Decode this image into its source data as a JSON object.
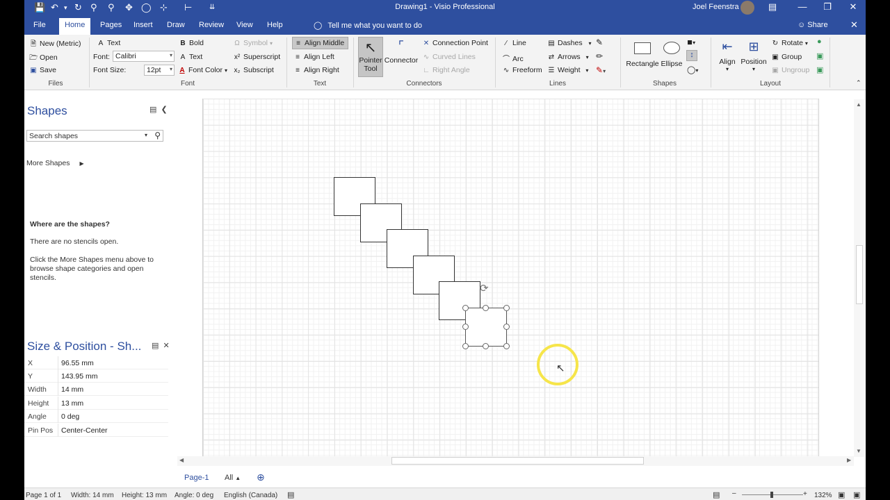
{
  "window": {
    "title": "Drawing1  -  Visio Professional",
    "user": "Joel Feenstra"
  },
  "tabs": [
    "File",
    "Home",
    "Pages",
    "Insert",
    "Draw",
    "Review",
    "View",
    "Help"
  ],
  "active_tab": "Home",
  "tell_me": "Tell me what you want to do",
  "share": "Share",
  "ribbon": {
    "files": {
      "label": "Files",
      "new": "New (Metric)",
      "open": "Open",
      "save": "Save"
    },
    "font": {
      "label": "Font",
      "text_btn": "Text",
      "font_label": "Font:",
      "font_value": "Calibri",
      "size_label": "Font Size:",
      "size_value": "12pt",
      "bold": "Bold",
      "text2": "Text",
      "font_color": "Font Color",
      "symbol": "Symbol",
      "superscript": "Superscript",
      "subscript": "Subscript"
    },
    "text": {
      "label": "Text",
      "align_middle": "Align Middle",
      "align_left": "Align Left",
      "align_right": "Align Right"
    },
    "connectors": {
      "label": "Connectors",
      "pointer_tool": "Pointer Tool",
      "connector": "Connector",
      "connection_point": "Connection Point",
      "curved_lines": "Curved Lines",
      "right_angle": "Right Angle"
    },
    "lines": {
      "label": "Lines",
      "line": "Line",
      "arc": "Arc",
      "freeform": "Freeform",
      "dashes": "Dashes",
      "arrows": "Arrows",
      "weight": "Weight"
    },
    "shapes": {
      "label": "Shapes",
      "rectangle": "Rectangle",
      "ellipse": "Ellipse"
    },
    "layout": {
      "label": "Layout",
      "align": "Align",
      "position": "Position",
      "rotate": "Rotate",
      "group": "Group",
      "ungroup": "Ungroup"
    }
  },
  "shapes_pane": {
    "title": "Shapes",
    "search_placeholder": "Search shapes",
    "more_shapes": "More Shapes",
    "where_heading": "Where are the shapes?",
    "no_stencils": "There are no stencils open.",
    "instructions": "Click the More Shapes menu above to browse shape categories and open stencils."
  },
  "size_position": {
    "title": "Size & Position - Sh...",
    "rows": [
      {
        "key": "X",
        "value": "96.55 mm"
      },
      {
        "key": "Y",
        "value": "143.95 mm"
      },
      {
        "key": "Width",
        "value": "14 mm"
      },
      {
        "key": "Height",
        "value": "13 mm"
      },
      {
        "key": "Angle",
        "value": "0 deg"
      },
      {
        "key": "Pin Pos",
        "value": "Center-Center"
      }
    ]
  },
  "page_tabs": {
    "page": "Page-1",
    "all": "All"
  },
  "status": {
    "page": "Page 1 of 1",
    "width": "Width: 14 mm",
    "height": "Height: 13 mm",
    "angle": "Angle: 0 deg",
    "language": "English (Canada)",
    "zoom": "132%"
  },
  "colors": {
    "accent": "#2e4f9f",
    "cursor_highlight": "#f6e54a"
  }
}
